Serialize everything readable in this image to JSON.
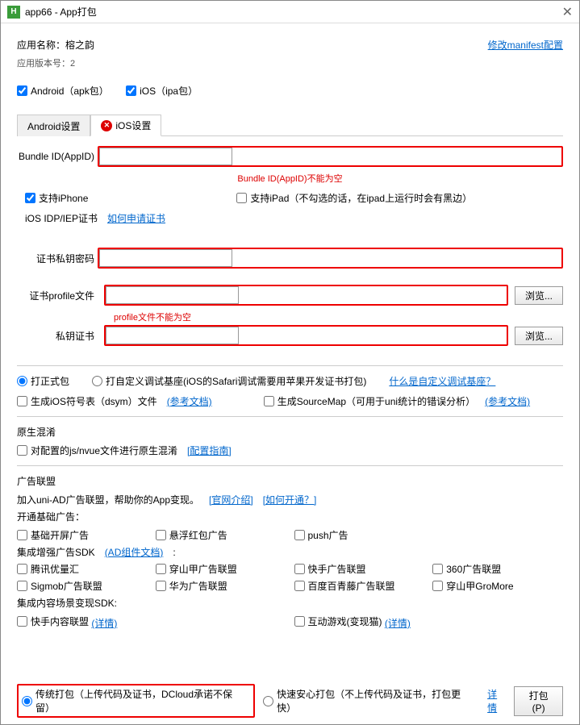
{
  "window": {
    "title": "app66 - App打包",
    "icon_text": "H"
  },
  "header": {
    "app_name_label": "应用名称：",
    "app_name": "榕之韵",
    "modify_manifest": "修改manifest配置",
    "version_label": "应用版本号：",
    "version": "2"
  },
  "platforms": {
    "android": "Android（apk包）",
    "ios": "iOS（ipa包）"
  },
  "tabs": {
    "android": "Android设置",
    "ios": "iOS设置"
  },
  "bundle": {
    "label": "Bundle ID(AppID)",
    "error": "Bundle ID(AppID)不能为空"
  },
  "support": {
    "iphone": "支持iPhone",
    "ipad": "支持iPad（不勾选的话，在ipad上运行时会有黑边）"
  },
  "cert": {
    "idp_label": "iOS IDP/IEP证书",
    "how_to_apply": "如何申请证书",
    "pwd_label": "证书私钥密码",
    "profile_label": "证书profile文件",
    "profile_error": "profile文件不能为空",
    "key_label": "私钥证书",
    "browse": "浏览..."
  },
  "pkg": {
    "release": "打正式包",
    "debug": "打自定义调试基座(iOS的Safari调试需要用苹果开发证书打包)",
    "what_is_debug": "什么是自定义调试基座？",
    "dsym": "生成iOS符号表（dsym）文件",
    "sourcemap": "生成SourceMap（可用于uni统计的错误分析）",
    "ref_doc": "(参考文档)"
  },
  "obf": {
    "title": "原生混淆",
    "opt": "对配置的js/nvue文件进行原生混淆",
    "guide": "[配置指南]"
  },
  "ad": {
    "title": "广告联盟",
    "intro": "加入uni-AD广告联盟，帮助你的App变现。",
    "official": "[官网介绍]",
    "how": "[如何开通？]",
    "basic_title": "开通基础广告：",
    "basic_splash": "基础开屏广告",
    "red_packet": "悬浮红包广告",
    "push": "push广告",
    "enhance_title": "集成增强广告SDK",
    "ad_comp_doc": "(AD组件文档)",
    "tencent": "腾讯优量汇",
    "pangle": "穿山甲广告联盟",
    "kuaishou": "快手广告联盟",
    "sdk360": "360广告联盟",
    "sigmob": "Sigmob广告联盟",
    "huawei": "华为广告联盟",
    "baidu": "百度百青藤广告联盟",
    "gromore": "穿山甲GroMore",
    "content_title": "集成内容场景变现SDK:",
    "ks_content": "快手内容联盟",
    "detail1": "(详情)",
    "inter_game": "互动游戏(变现猫)",
    "detail2": "(详情)"
  },
  "footer": {
    "trad": "传统打包（上传代码及证书，DCloud承诺不保留）",
    "fast": "快速安心打包（不上传代码及证书，打包更快）",
    "detail": "详情",
    "build": "打包(P)"
  }
}
